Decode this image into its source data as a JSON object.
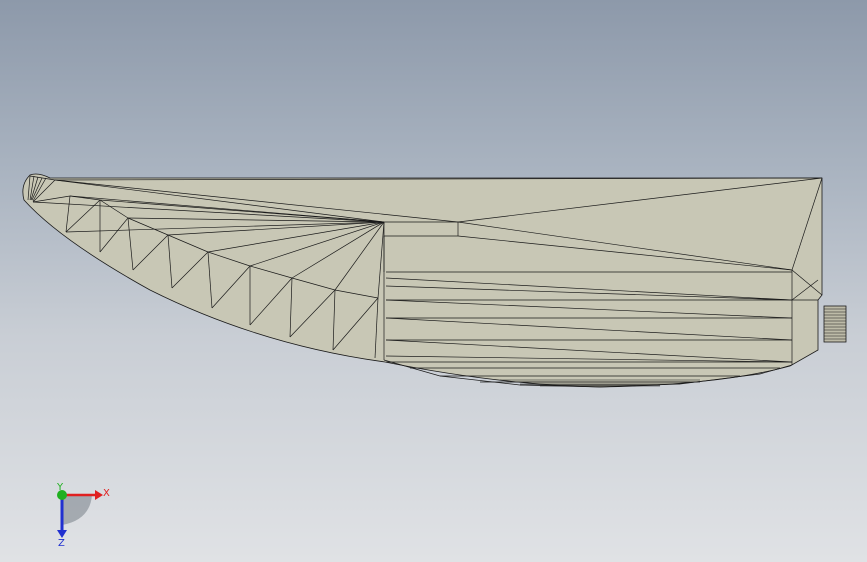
{
  "viewport": {
    "background_top": "#8d99aa",
    "background_bottom": "#e0e2e5"
  },
  "model": {
    "face_color": "#c8c7b5",
    "edge_color": "#1a1a1a",
    "knob_color": "#bdbba8"
  },
  "triad": {
    "x_label": "X",
    "y_label": "Y",
    "z_label": "Z",
    "x_color": "#e02020",
    "y_color": "#20b020",
    "z_color": "#2030d0"
  }
}
